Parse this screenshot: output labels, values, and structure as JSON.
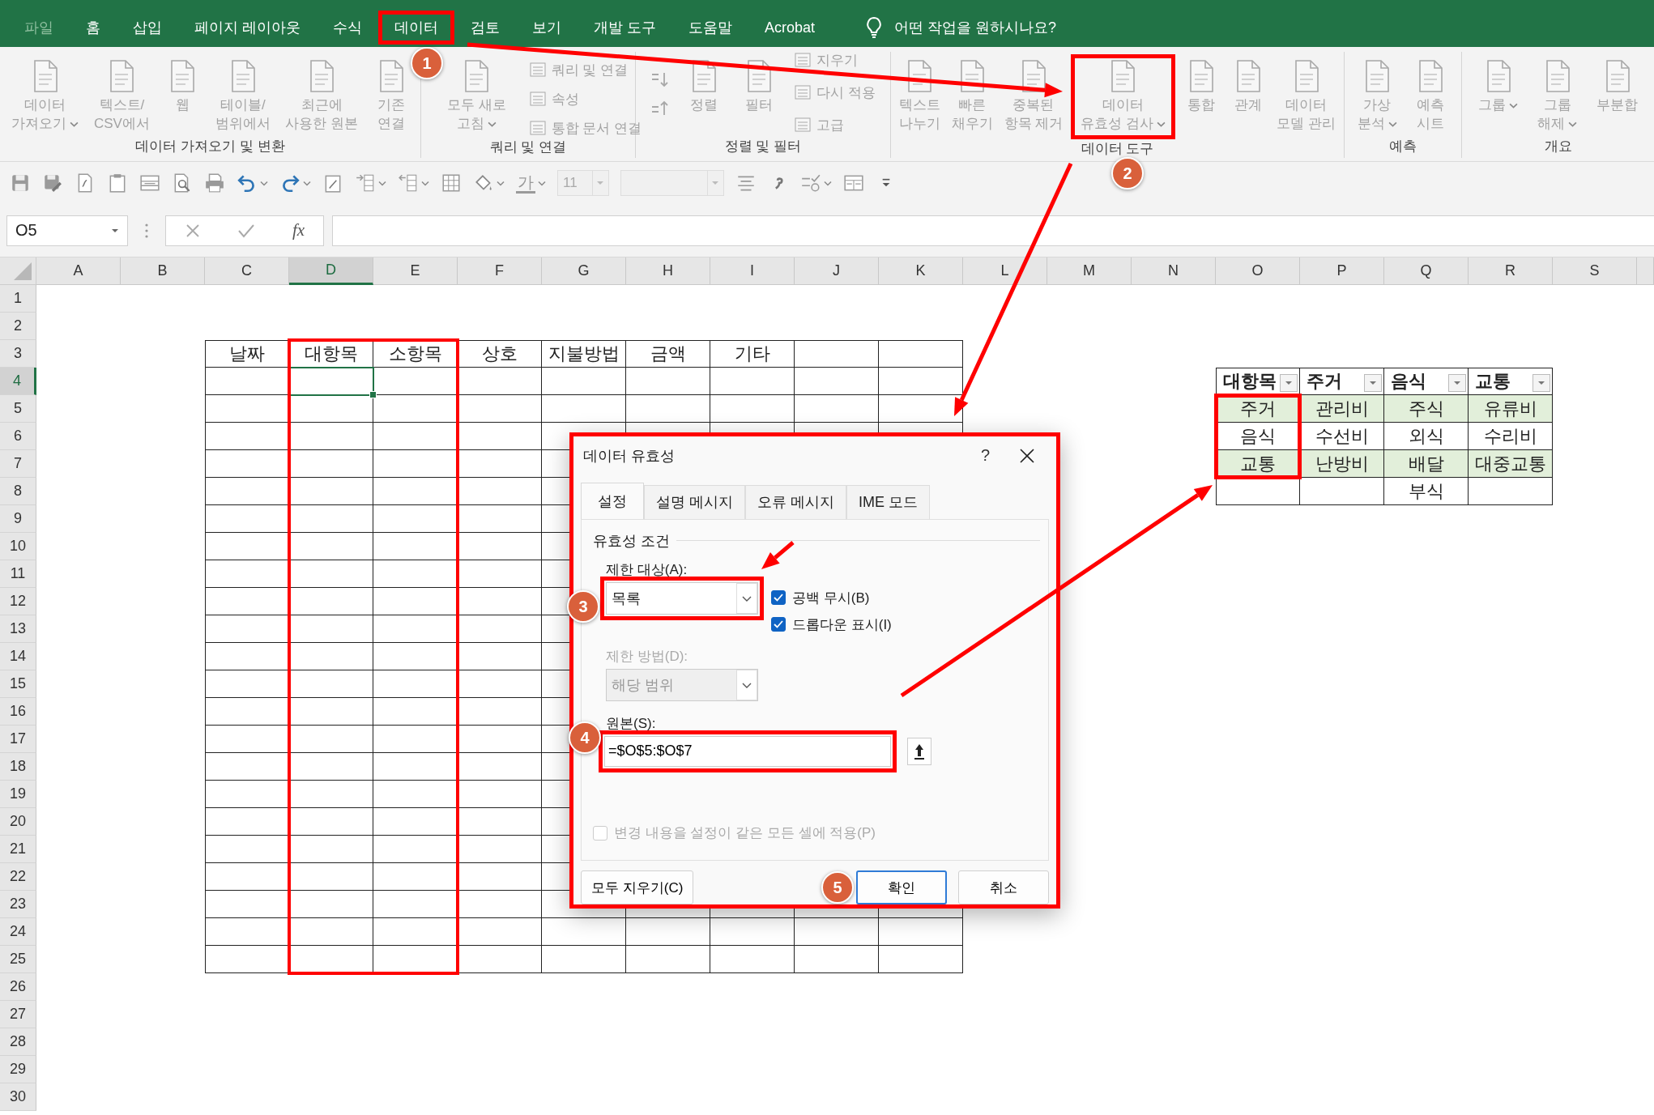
{
  "ribbon_tabs": [
    {
      "label": "파일",
      "disabled": true,
      "highlighted": false
    },
    {
      "label": "홈",
      "disabled": false,
      "highlighted": false
    },
    {
      "label": "삽입",
      "disabled": false,
      "highlighted": false
    },
    {
      "label": "페이지 레이아웃",
      "disabled": false,
      "highlighted": false
    },
    {
      "label": "수식",
      "disabled": false,
      "highlighted": false
    },
    {
      "label": "데이터",
      "disabled": false,
      "highlighted": true
    },
    {
      "label": "검토",
      "disabled": false,
      "highlighted": false
    },
    {
      "label": "보기",
      "disabled": false,
      "highlighted": false
    },
    {
      "label": "개발 도구",
      "disabled": false,
      "highlighted": false
    },
    {
      "label": "도움말",
      "disabled": false,
      "highlighted": false
    },
    {
      "label": "Acrobat",
      "disabled": false,
      "highlighted": false
    }
  ],
  "tell_me": {
    "placeholder": "어떤 작업을 원하시나요?"
  },
  "ribbon_groups": [
    {
      "label": "데이터 가져오기 및 변환",
      "buttons": [
        {
          "kind": "large",
          "label": "데이터\n가져오기",
          "dropdown": true,
          "highlighted": false
        },
        {
          "kind": "large",
          "label": "텍스트/\nCSV에서",
          "dropdown": false,
          "highlighted": false
        },
        {
          "kind": "large",
          "label": "웹",
          "dropdown": false,
          "highlighted": false
        },
        {
          "kind": "large",
          "label": "테이블/\n범위에서",
          "dropdown": false,
          "highlighted": false
        },
        {
          "kind": "large",
          "label": "최근에\n사용한 원본",
          "dropdown": false,
          "highlighted": false
        },
        {
          "kind": "large",
          "label": "기존\n연결",
          "dropdown": false,
          "highlighted": false
        }
      ]
    },
    {
      "label": "쿼리 및 연결",
      "buttons": [
        {
          "kind": "large",
          "label": "모두 새로\n고침",
          "dropdown": true,
          "highlighted": false
        },
        {
          "kind": "small",
          "label": "쿼리 및 연결",
          "dropdown": false,
          "highlighted": false
        },
        {
          "kind": "small",
          "label": "속성",
          "dropdown": false,
          "highlighted": false
        },
        {
          "kind": "small",
          "label": "통합 문서 연결",
          "dropdown": false,
          "highlighted": false
        }
      ]
    },
    {
      "label": "정렬 및 필터",
      "buttons": [
        {
          "kind": "sort",
          "dropdown": false,
          "highlighted": false
        },
        {
          "kind": "large",
          "label": "정렬",
          "dropdown": false,
          "highlighted": false
        },
        {
          "kind": "large",
          "label": "필터",
          "dropdown": false,
          "highlighted": false
        },
        {
          "kind": "small",
          "label": "지우기",
          "dropdown": false,
          "highlighted": false
        },
        {
          "kind": "small",
          "label": "다시 적용",
          "dropdown": false,
          "highlighted": false
        },
        {
          "kind": "small",
          "label": "고급",
          "dropdown": false,
          "highlighted": false
        }
      ]
    },
    {
      "label": "데이터 도구",
      "buttons": [
        {
          "kind": "large",
          "label": "텍스트\n나누기",
          "dropdown": false,
          "highlighted": false
        },
        {
          "kind": "large",
          "label": "빠른\n채우기",
          "dropdown": false,
          "highlighted": false
        },
        {
          "kind": "large",
          "label": "중복된\n항목 제거",
          "dropdown": false,
          "highlighted": false
        },
        {
          "kind": "large",
          "label": "데이터\n유효성 검사",
          "dropdown": true,
          "highlighted": true
        },
        {
          "kind": "large",
          "label": "통합",
          "dropdown": false,
          "highlighted": false
        },
        {
          "kind": "large",
          "label": "관계",
          "dropdown": false,
          "highlighted": false
        },
        {
          "kind": "large",
          "label": "데이터\n모델 관리",
          "dropdown": false,
          "highlighted": false
        }
      ]
    },
    {
      "label": "예측",
      "buttons": [
        {
          "kind": "large",
          "label": "가상\n분석",
          "dropdown": true,
          "highlighted": false
        },
        {
          "kind": "large",
          "label": "예측\n시트",
          "dropdown": false,
          "highlighted": false
        }
      ]
    },
    {
      "label": "개요",
      "buttons": [
        {
          "kind": "large",
          "label": "그룹",
          "dropdown": true,
          "highlighted": false
        },
        {
          "kind": "large",
          "label": "그룹\n해제",
          "dropdown": true,
          "highlighted": false
        },
        {
          "kind": "large",
          "label": "부분합",
          "dropdown": false,
          "highlighted": false
        }
      ]
    }
  ],
  "toolbar": {
    "font_color_glyph": "가",
    "font_size": "11"
  },
  "formula_bar": {
    "name_box": "O5",
    "function_button": "fx"
  },
  "sheet": {
    "columns": [
      {
        "label": "A",
        "selected": false
      },
      {
        "label": "B",
        "selected": false
      },
      {
        "label": "C",
        "selected": false
      },
      {
        "label": "D",
        "selected": true
      },
      {
        "label": "E",
        "selected": false
      },
      {
        "label": "F",
        "selected": false
      },
      {
        "label": "G",
        "selected": false
      },
      {
        "label": "H",
        "selected": false
      },
      {
        "label": "I",
        "selected": false
      },
      {
        "label": "J",
        "selected": false
      },
      {
        "label": "K",
        "selected": false
      },
      {
        "label": "L",
        "selected": false
      },
      {
        "label": "M",
        "selected": false
      },
      {
        "label": "N",
        "selected": false
      },
      {
        "label": "O",
        "selected": false
      },
      {
        "label": "P",
        "selected": false
      },
      {
        "label": "Q",
        "selected": false
      },
      {
        "label": "R",
        "selected": false
      },
      {
        "label": "S",
        "selected": false
      }
    ],
    "rows": [
      {
        "label": "1",
        "selected": false
      },
      {
        "label": "2",
        "selected": false
      },
      {
        "label": "3",
        "selected": false
      },
      {
        "label": "4",
        "selected": true
      },
      {
        "label": "5",
        "selected": false
      },
      {
        "label": "6",
        "selected": false
      },
      {
        "label": "7",
        "selected": false
      },
      {
        "label": "8",
        "selected": false
      },
      {
        "label": "9",
        "selected": false
      },
      {
        "label": "10",
        "selected": false
      },
      {
        "label": "11",
        "selected": false
      },
      {
        "label": "12",
        "selected": false
      },
      {
        "label": "13",
        "selected": false
      },
      {
        "label": "14",
        "selected": false
      },
      {
        "label": "15",
        "selected": false
      },
      {
        "label": "16",
        "selected": false
      },
      {
        "label": "17",
        "selected": false
      },
      {
        "label": "18",
        "selected": false
      },
      {
        "label": "19",
        "selected": false
      },
      {
        "label": "20",
        "selected": false
      },
      {
        "label": "21",
        "selected": false
      },
      {
        "label": "22",
        "selected": false
      },
      {
        "label": "23",
        "selected": false
      },
      {
        "label": "24",
        "selected": false
      },
      {
        "label": "25",
        "selected": false
      },
      {
        "label": "26",
        "selected": false
      },
      {
        "label": "27",
        "selected": false
      },
      {
        "label": "28",
        "selected": false
      },
      {
        "label": "29",
        "selected": false
      },
      {
        "label": "30",
        "selected": false
      }
    ],
    "expense_table": {
      "headers": [
        {
          "label": "날짜",
          "highlighted": false
        },
        {
          "label": "대항목",
          "highlighted": true
        },
        {
          "label": "소항목",
          "highlighted": true
        },
        {
          "label": "상호",
          "highlighted": false
        },
        {
          "label": "지불방법",
          "highlighted": false
        },
        {
          "label": "금액",
          "highlighted": false
        },
        {
          "label": "기타",
          "highlighted": false
        }
      ]
    },
    "lookup_table": {
      "columns": [
        {
          "header": "대항목",
          "items": [
            {
              "label": "주거",
              "shaded": true,
              "highlighted": true
            },
            {
              "label": "음식",
              "shaded": false,
              "highlighted": true
            },
            {
              "label": "교통",
              "shaded": true,
              "highlighted": true
            }
          ]
        },
        {
          "header": "주거",
          "items": [
            {
              "label": "관리비",
              "shaded": true,
              "highlighted": false
            },
            {
              "label": "수선비",
              "shaded": false,
              "highlighted": false
            },
            {
              "label": "난방비",
              "shaded": true,
              "highlighted": false
            }
          ]
        },
        {
          "header": "음식",
          "items": [
            {
              "label": "주식",
              "shaded": true,
              "highlighted": false
            },
            {
              "label": "외식",
              "shaded": false,
              "highlighted": false
            },
            {
              "label": "배달",
              "shaded": true,
              "highlighted": false
            },
            {
              "label": "부식",
              "shaded": false,
              "highlighted": false
            }
          ]
        },
        {
          "header": "교통",
          "items": [
            {
              "label": "유류비",
              "shaded": true,
              "highlighted": false
            },
            {
              "label": "수리비",
              "shaded": false,
              "highlighted": false
            },
            {
              "label": "대중교통",
              "shaded": true,
              "highlighted": false
            }
          ]
        }
      ]
    }
  },
  "dialog": {
    "title": "데이터 유효성",
    "help": "?",
    "highlighted": true,
    "tabs": [
      {
        "label": "설정",
        "selected": true
      },
      {
        "label": "설명 메시지",
        "selected": false
      },
      {
        "label": "오류 메시지",
        "selected": false
      },
      {
        "label": "IME 모드",
        "selected": false
      }
    ],
    "section": "유효성 조건",
    "allow": {
      "label": "제한 대상(A):",
      "value": "목록",
      "highlighted": true
    },
    "checkboxes": [
      {
        "label": "공백 무시(B)",
        "checked": true
      },
      {
        "label": "드롭다운 표시(I)",
        "checked": true
      }
    ],
    "data": {
      "label": "제한 방법(D):",
      "value": "해당 범위",
      "disabled": true
    },
    "source": {
      "label": "원본(S):",
      "value": "=$O$5:$O$7",
      "highlighted": true
    },
    "apply_all": {
      "label": "변경 내용을 설정이 같은 모든 셀에 적용(P)",
      "checked": false,
      "disabled": true
    },
    "buttons": [
      {
        "label": "모두 지우기(C)",
        "default": false
      },
      {
        "label": "확인",
        "default": true
      },
      {
        "label": "취소",
        "default": false
      }
    ]
  },
  "callouts": [
    "1",
    "2",
    "3",
    "4",
    "5"
  ]
}
